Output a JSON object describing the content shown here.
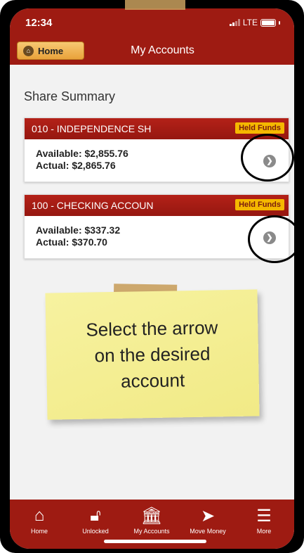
{
  "status": {
    "time": "12:34",
    "network": "LTE"
  },
  "header": {
    "home_label": "Home",
    "title": "My Accounts"
  },
  "section": {
    "title": "Share Summary"
  },
  "accounts": [
    {
      "name": "010 - INDEPENDENCE SH",
      "badge": "Held Funds",
      "available": "Available: $2,855.76",
      "actual": "Actual: $2,865.76"
    },
    {
      "name": "100 - CHECKING ACCOUN",
      "badge": "Held Funds",
      "available": "Available: $337.32",
      "actual": "Actual: $370.70"
    }
  ],
  "note": {
    "lines": [
      "Select the arrow",
      "on the desired",
      "account"
    ]
  },
  "tabs": [
    {
      "label": "Home",
      "icon": "home-icon"
    },
    {
      "label": "Unlocked",
      "icon": "unlock-icon"
    },
    {
      "label": "My Accounts",
      "icon": "bank-icon"
    },
    {
      "label": "Move Money",
      "icon": "send-icon"
    },
    {
      "label": "More",
      "icon": "menu-icon"
    }
  ],
  "colors": {
    "brand": "#9e1b12",
    "badge": "#f5b800",
    "home_button": "#f0b14f",
    "note": "#f4ee93"
  }
}
